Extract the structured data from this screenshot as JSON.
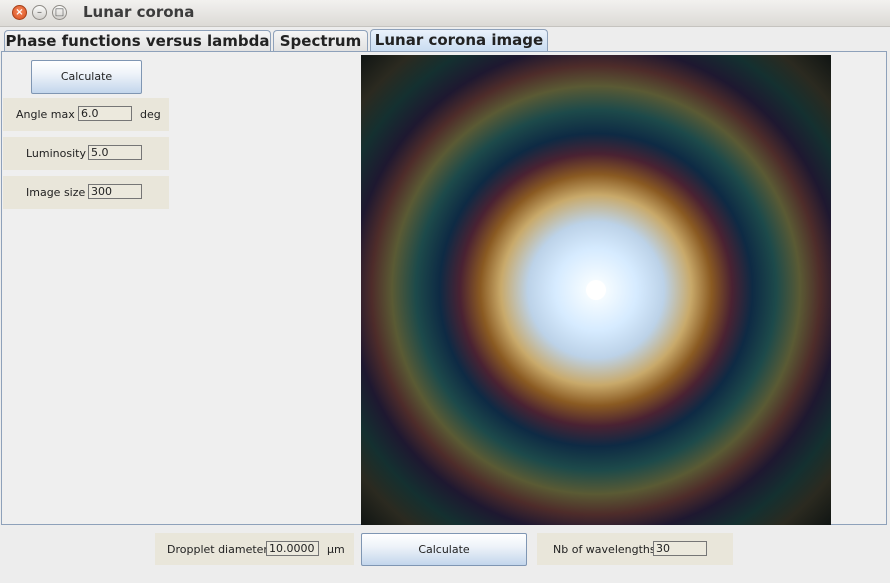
{
  "window": {
    "title": "Lunar corona",
    "controls": {
      "close": "×",
      "minimize": "–",
      "maximize": "□"
    }
  },
  "tabs": [
    {
      "label": "Phase functions versus lambda",
      "selected": false
    },
    {
      "label": "Spectrum",
      "selected": false
    },
    {
      "label": "Lunar corona image",
      "selected": true
    }
  ],
  "left_panel": {
    "calculate_label": "Calculate",
    "angle_max": {
      "label": "Angle max",
      "value": "6.0",
      "unit": "deg"
    },
    "luminosity": {
      "label": "Luminosity",
      "value": "5.0"
    },
    "image_size": {
      "label": "Image size",
      "value": "300"
    }
  },
  "bottom_bar": {
    "droplet_diameter": {
      "label": "Dropplet diameter",
      "value": "10.0000",
      "unit": "µm"
    },
    "calculate_label": "Calculate",
    "nb_wavelengths": {
      "label": "Nb of wavelengths",
      "value": "30"
    }
  },
  "colors": {
    "tab_border": "#8ea1ba",
    "field_bg": "#e9e6da",
    "corona_center": "#ffffff",
    "corona_inner": "#cfe6ff",
    "corona_bg": "#0a1010"
  }
}
